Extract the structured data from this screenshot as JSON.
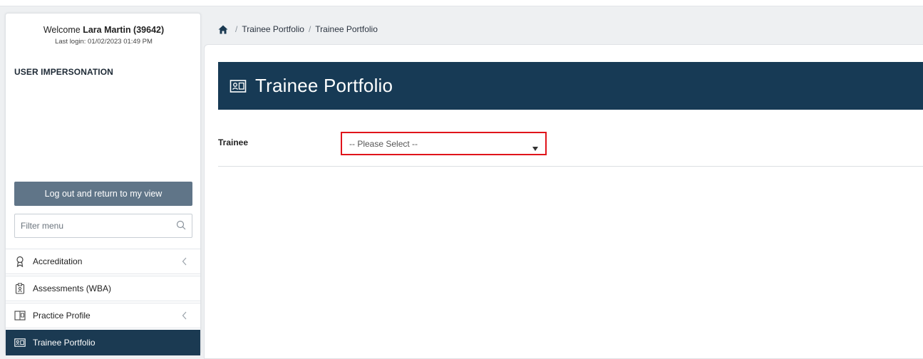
{
  "user": {
    "welcome_prefix": "Welcome",
    "name": "Lara Martin (39642)",
    "last_login": "Last login: 01/02/2023 01:49 PM"
  },
  "sidebar": {
    "impersonation_heading": "USER IMPERSONATION",
    "logout_label": "Log out and return to my view",
    "filter_placeholder": "Filter menu",
    "items": [
      {
        "label": "Accreditation",
        "icon": "ribbon-icon",
        "has_chevron": true,
        "active": false
      },
      {
        "label": "Assessments (WBA)",
        "icon": "clipboard-icon",
        "has_chevron": false,
        "active": false
      },
      {
        "label": "Practice Profile",
        "icon": "book-icon",
        "has_chevron": true,
        "active": false
      },
      {
        "label": "Trainee Portfolio",
        "icon": "id-card-icon",
        "has_chevron": false,
        "active": true
      }
    ]
  },
  "breadcrumb": {
    "items": [
      "Trainee Portfolio",
      "Trainee Portfolio"
    ]
  },
  "page": {
    "title": "Trainee Portfolio",
    "trainee_label": "Trainee",
    "trainee_select_value": "-- Please Select --"
  },
  "colors": {
    "header_bg": "#173a55",
    "active_menu_bg": "#1b3a52",
    "logout_button_bg": "#607588",
    "highlight_border": "#e0141b"
  }
}
